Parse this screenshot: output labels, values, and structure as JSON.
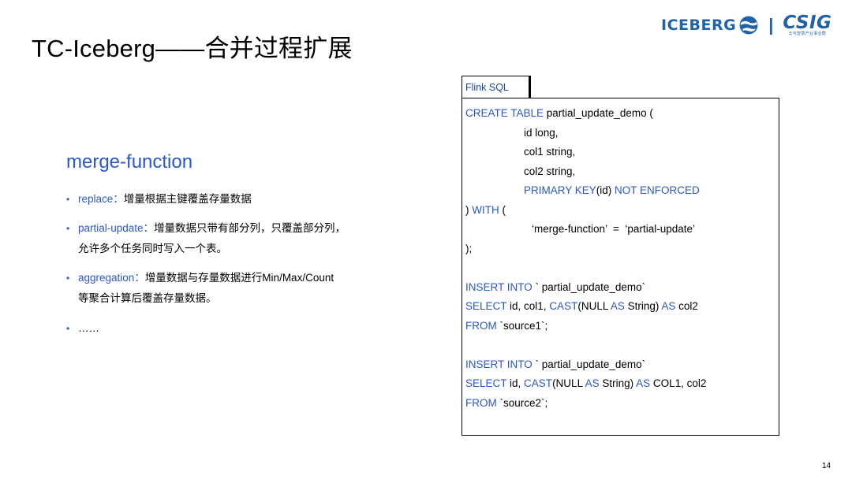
{
  "slide": {
    "title": "TC-Iceberg——合并过程扩展",
    "page_number": "14"
  },
  "logos": {
    "iceberg_text": "ICEBERG",
    "separator": "|",
    "csig_text": "CSIG",
    "csig_subtitle": "云与智慧产业事业群"
  },
  "left": {
    "heading": "merge-function",
    "bullets": [
      {
        "term": "replace：",
        "desc_lines": [
          "增量根据主键覆盖存量数据"
        ]
      },
      {
        "term": "partial-update：",
        "desc_lines": [
          "增量数据只带有部分列，只覆盖部分列，",
          "允许多个任务同时写入一个表。"
        ]
      },
      {
        "term": "aggregation：",
        "desc_lines": [
          "增量数据与存量数据进行Min/Max/Count",
          "等聚合计算后覆盖存量数据。"
        ]
      },
      {
        "term": "",
        "desc_lines": [
          "……"
        ]
      }
    ]
  },
  "code": {
    "tab_label": "Flink SQL",
    "lines": {
      "l1_kw": "CREATE TABLE",
      "l1_rest": " partial_update_demo (",
      "l2": "id long,",
      "l3": "col1 string,",
      "l4": "col2 string,",
      "l5_kw": "PRIMARY KEY",
      "l5_mid": "(id) ",
      "l5_kw2": "NOT ENFORCED",
      "l6_plain": ") ",
      "l6_kw": "WITH",
      "l6_rest": " (",
      "l7": "‘merge-function’  =  ‘partial-update’",
      "l8": ");",
      "l10_kw": "INSERT INTO",
      "l10_rest": " ` partial_update_demo`",
      "l11_kw": "SELECT",
      "l11_a": " id, col1, ",
      "l11_kw2": "CAST",
      "l11_b": "(NULL ",
      "l11_kw3": "AS",
      "l11_c": " String) ",
      "l11_kw4": "AS",
      "l11_d": " col2",
      "l12_kw": "FROM",
      "l12_rest": " `source1`;",
      "l14_kw": "INSERT INTO",
      "l14_rest": " ` partial_update_demo`",
      "l15_kw": "SELECT",
      "l15_a": " id, ",
      "l15_kw2": "CAST",
      "l15_b": "(NULL ",
      "l15_kw3": "AS",
      "l15_c": " String) ",
      "l15_kw4": "AS",
      "l15_d": " COL1, col2",
      "l16_kw": "FROM",
      "l16_rest": " `source2`;"
    }
  },
  "colors": {
    "accent_blue": "#2b58c6",
    "logo_blue": "#1e63a8"
  },
  "icons": {
    "globe": "globe-icon"
  }
}
